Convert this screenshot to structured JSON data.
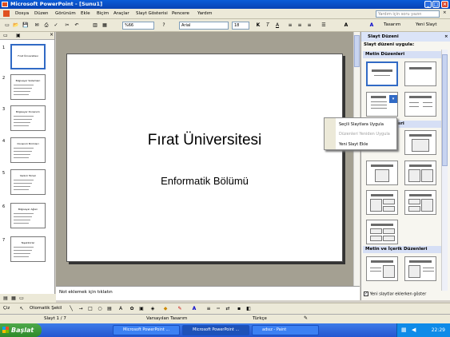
{
  "window": {
    "title": "Microsoft PowerPoint - [Sunu1]"
  },
  "menu": {
    "items": [
      "Dosya",
      "Düzen",
      "Görünüm",
      "Ekle",
      "Biçim",
      "Araçlar",
      "Slayt Gösterisi",
      "Pencere",
      "Yardım"
    ],
    "help_placeholder": "Yardım için soru yazın"
  },
  "toolbar": {
    "zoom": "%66",
    "font": "Arial",
    "font_size": "18",
    "bold": "K",
    "italic": "T",
    "underline": "A",
    "design_label": "Tasarım",
    "new_slide_label": "Yeni Slayt"
  },
  "outline": {
    "slides": [
      {
        "num": "1",
        "title": "Fırat Üniversitesi"
      },
      {
        "num": "2",
        "title": "Bilgisayar Sistemleri"
      },
      {
        "num": "3",
        "title": "Bilgisayar Donanımı"
      },
      {
        "num": "4",
        "title": "Donanım Birimleri"
      },
      {
        "num": "5",
        "title": "Yazılım Türleri"
      },
      {
        "num": "6",
        "title": "Bilgisayar Ağları"
      },
      {
        "num": "7",
        "title": "Teşekkürler"
      }
    ]
  },
  "slide": {
    "title": "Fırat Üniversitesi",
    "subtitle": "Enformatik Bölümü"
  },
  "notes": {
    "placeholder": "Not eklemek için tıklatın"
  },
  "taskpane": {
    "title": "Slayt Düzeni",
    "apply_label": "Slayt düzeni uygula:",
    "section_text": "Metin Düzenleri",
    "section_content": "İçerik Düzenleri",
    "section_text_content": "Metin ve İçerik Düzenleri",
    "show_on_new_label": "Yeni slaytlar eklerken göster"
  },
  "context_menu": {
    "items": [
      {
        "label": "Seçili Slaytlara Uygula",
        "enabled": true
      },
      {
        "label": "Düzenleri Yeniden Uygula",
        "enabled": false
      },
      {
        "label": "Yeni Slayt Ekle",
        "enabled": true
      }
    ]
  },
  "drawing": {
    "draw_label": "Çiz",
    "autoshapes_label": "Otomatik Şekil"
  },
  "status": {
    "slide_position": "Slayt 1 / 7",
    "design": "Varsayılan Tasarım",
    "language": "Türkçe"
  },
  "taskbar": {
    "start_label": "Başlat",
    "tasks": [
      "Microsoft PowerPoint ...",
      "Microsoft PowerPoint ...",
      "adsız - Paint"
    ],
    "clock": "22:29"
  },
  "colors": {
    "titlebar": "#0842b4",
    "selection": "#316ac5",
    "taskbar": "#2456d0"
  }
}
